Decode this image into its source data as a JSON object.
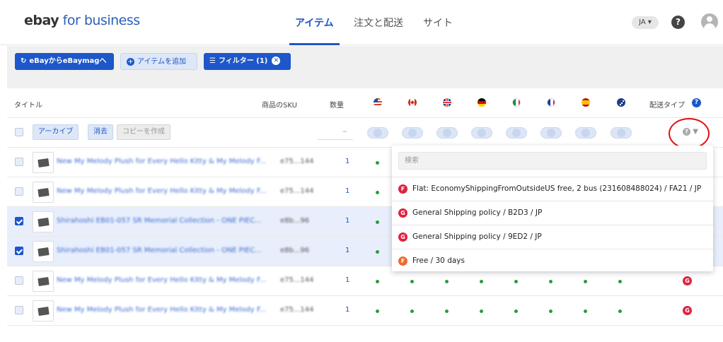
{
  "header": {
    "logo_ebay": "ebay",
    "logo_biz": "for business",
    "tabs": [
      {
        "label": "アイテム"
      },
      {
        "label": "注文と配送"
      },
      {
        "label": "サイト"
      }
    ],
    "lang": "JA ▾",
    "help": "?"
  },
  "toolbar": {
    "sync_label": "eBayからeBaymagへ",
    "add_label": "アイテムを追加",
    "filter_label": "フィルター (1)"
  },
  "table": {
    "col_title": "タイトル",
    "col_sku": "商品のSKU",
    "col_qty": "数量",
    "col_shipping": "配送タイプ",
    "actions": {
      "archive": "アーカイブ",
      "delete": "消去",
      "copy": "コピーを作成"
    },
    "qty_placeholder": "~",
    "rows": [
      {
        "title": "New My Melody Plush for Every Hello Kitty & My Melody F...",
        "sku": "e75...144",
        "qty": "1",
        "checked": false,
        "selected": false,
        "ship": ""
      },
      {
        "title": "New My Melody Plush for Every Hello Kitty & My Melody F...",
        "sku": "e75...144",
        "qty": "1",
        "checked": false,
        "selected": false,
        "ship": ""
      },
      {
        "title": "Shirahoshi EB01-057 SR Memorial Collection - ONE PIEC...",
        "sku": "e8b...96",
        "qty": "1",
        "checked": true,
        "selected": true,
        "ship": ""
      },
      {
        "title": "Shirahoshi EB01-057 SR Memorial Collection - ONE PIEC...",
        "sku": "e8b...96",
        "qty": "1",
        "checked": true,
        "selected": true,
        "ship": ""
      },
      {
        "title": "New My Melody Plush for Every Hello Kitty & My Melody F...",
        "sku": "e75...144",
        "qty": "1",
        "checked": false,
        "selected": false,
        "ship": "G"
      },
      {
        "title": "New My Melody Plush for Every Hello Kitty & My Melody F...",
        "sku": "e75...144",
        "qty": "1",
        "checked": false,
        "selected": false,
        "ship": "G"
      }
    ]
  },
  "dropdown": {
    "search_placeholder": "検索",
    "options": [
      {
        "icon": "F",
        "color": "#e0223f",
        "label": "Flat: EconomyShippingFromOutsideUS free, 2 bus (231608488024) / FA21 / JP"
      },
      {
        "icon": "G",
        "color": "#e0223f",
        "label": "General Shipping policy / B2D3 / JP"
      },
      {
        "icon": "G",
        "color": "#e0223f",
        "label": "General Shipping policy / 9ED2 / JP"
      },
      {
        "icon": "F",
        "color": "#f06a2a",
        "label": "Free / 30 days"
      }
    ]
  },
  "colors": {
    "accent": "#1d57c9",
    "dot": "#2c9b3b",
    "highlight": "#e01010"
  }
}
